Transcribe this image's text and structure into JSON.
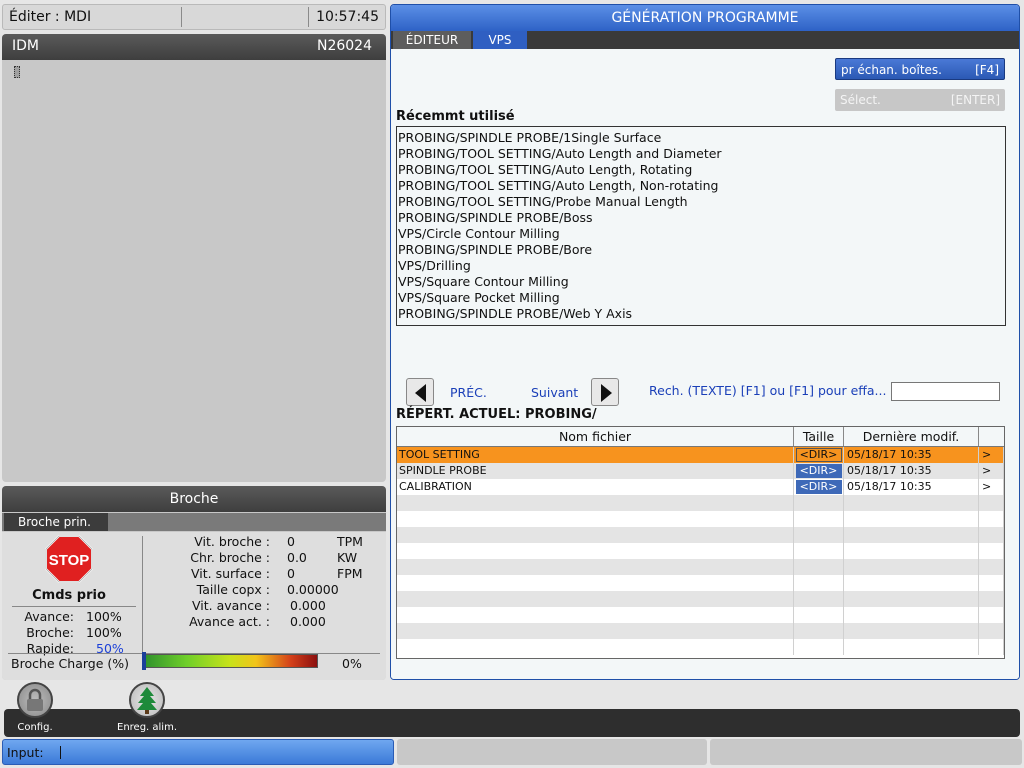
{
  "topbar": {
    "mode": "Éditer : MDI",
    "clock": "10:57:45"
  },
  "editor": {
    "title": "IDM",
    "line": "N26024"
  },
  "spindle": {
    "title": "Broche",
    "tab": "Broche prin.",
    "overrides_title": "Cmds prio",
    "overrides": [
      {
        "label": "Avance:",
        "value": "100%"
      },
      {
        "label": "Broche:",
        "value": "100%"
      },
      {
        "label": "Rapide:",
        "value": "50%"
      }
    ],
    "stats": [
      {
        "label": "Vit. broche :",
        "value": "0",
        "unit": "TPM"
      },
      {
        "label": "Chr. broche :",
        "value": "0.0",
        "unit": "KW"
      },
      {
        "label": "Vit. surface :",
        "value": "0",
        "unit": "FPM"
      },
      {
        "label": "Taille copx :",
        "value": "0.00000",
        "unit": ""
      },
      {
        "label": "Vit. avance :",
        "value": "0.000",
        "unit": ""
      },
      {
        "label": "Avance act. :",
        "value": "0.000",
        "unit": ""
      }
    ],
    "load_label": "Broche Charge (%)",
    "load_value": "0%",
    "load_fraction": 0
  },
  "program": {
    "title": "GÉNÉRATION PROGRAMME",
    "tabs": [
      "ÉDITEUR",
      "VPS"
    ],
    "btn_f4": {
      "label": "pr échan. boîtes.",
      "key": "[F4]"
    },
    "btn_enter": {
      "label": "Sélect.",
      "key": "[ENTER]"
    },
    "recent_title": "Récemmt utilisé",
    "recent": [
      "PROBING/SPINDLE PROBE/1Single Surface",
      "PROBING/TOOL SETTING/Auto Length and Diameter",
      "PROBING/TOOL SETTING/Auto Length, Rotating",
      "PROBING/TOOL SETTING/Auto Length, Non-rotating",
      "PROBING/TOOL SETTING/Probe Manual Length",
      "PROBING/SPINDLE PROBE/Boss",
      "VPS/Circle Contour Milling",
      "PROBING/SPINDLE PROBE/Bore",
      "VPS/Drilling",
      "VPS/Square Contour Milling",
      "VPS/Square Pocket Milling",
      "PROBING/SPINDLE PROBE/Web Y Axis"
    ],
    "prev_label": "PRÉC.",
    "next_label": "Suivant",
    "search_label": "Rech. (TEXTE) [F1] ou [F1] pour effa...",
    "search_value": "",
    "current_dir": "RÉPERT. ACTUEL: PROBING/",
    "table_headers": [
      "Nom fichier",
      "Taille",
      "Dernière modif.",
      ""
    ],
    "files": [
      {
        "name": "TOOL SETTING",
        "size": "<DIR>",
        "modified": "05/18/17 10:35",
        "arrow": ">"
      },
      {
        "name": "SPINDLE PROBE",
        "size": "<DIR>",
        "modified": "05/18/17 10:35",
        "arrow": ">"
      },
      {
        "name": "CALIBRATION",
        "size": "<DIR>",
        "modified": "05/18/17 10:35",
        "arrow": ">"
      }
    ]
  },
  "toolbar": {
    "config_label": "Config.",
    "save_label": "Enreg. alim."
  },
  "status": {
    "input_label": "Input:"
  }
}
